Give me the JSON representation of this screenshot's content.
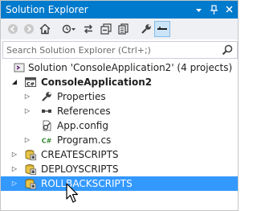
{
  "window": {
    "title": "Solution Explorer",
    "title_icons": [
      "dropdown-icon",
      "pin-icon",
      "close-icon"
    ]
  },
  "toolbar": {
    "buttons": [
      "back-icon",
      "forward-icon",
      "home-icon",
      "pending-changes-icon",
      "sync-icon",
      "collapse-all-icon",
      "show-all-files-icon",
      "properties-icon",
      "preview-icon"
    ]
  },
  "search": {
    "placeholder": "Search Solution Explorer (Ctrl+;)"
  },
  "tree": {
    "solution": "Solution 'ConsoleApplication2' (4 projects)",
    "project": "ConsoleApplication2",
    "project_badge": "C#",
    "items": [
      {
        "label": "Properties",
        "icon": "wrench-icon"
      },
      {
        "label": "References",
        "icon": "references-icon"
      },
      {
        "label": "App.config",
        "icon": "config-file-icon"
      },
      {
        "label": "Program.cs",
        "icon": "csharp-file-icon",
        "badge": "C#"
      }
    ],
    "projects": [
      {
        "label": "CREATESCRIPTS",
        "selected": false
      },
      {
        "label": "DEPLOYSCRIPTS",
        "selected": false
      },
      {
        "label": "ROLLBACKSCRIPTS",
        "selected": true
      }
    ]
  },
  "colors": {
    "accent": "#007acc",
    "selection": "#3399ff",
    "toolbar_bg": "#eef0f3"
  }
}
